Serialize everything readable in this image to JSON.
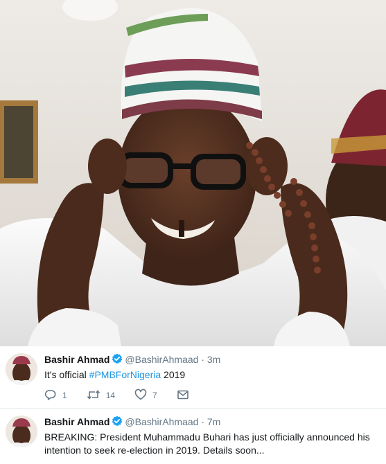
{
  "photo": {
    "alt": "Man in white embroidered cap adjusting black-framed glasses, holding prayer beads"
  },
  "tweets": [
    {
      "name": "Bashir Ahmad",
      "handle": "@BashirAhmaad",
      "separator": "·",
      "time": "3m",
      "text_before": "It's official ",
      "hashtag": "#PMBForNigeria",
      "text_after": " 2019",
      "reply_count": "1",
      "retweet_count": "14",
      "like_count": "7"
    },
    {
      "name": "Bashir Ahmad",
      "handle": "@BashirAhmaad",
      "separator": "·",
      "time": "7m",
      "text": "BREAKING: President Muhammadu Buhari has just officially announced his intention to seek re-election in 2019. Details soon..."
    }
  ],
  "icons": {
    "verified": "verified-badge-icon",
    "reply": "reply-icon",
    "retweet": "retweet-icon",
    "like": "heart-icon",
    "dm": "envelope-icon"
  },
  "colors": {
    "link": "#1b95e0",
    "secondary_text": "#657786",
    "verified": "#1da1f2",
    "divider": "#e6ecf0"
  }
}
